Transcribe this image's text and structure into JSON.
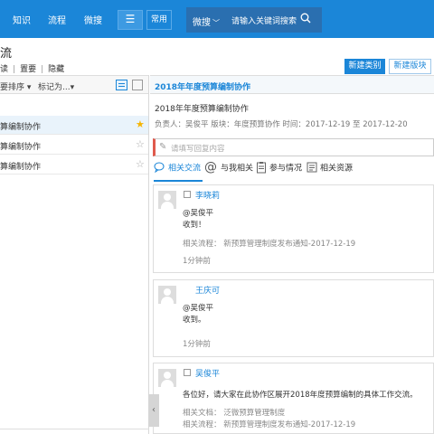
{
  "topnav": {
    "items": [
      "知识",
      "流程",
      "微搜"
    ],
    "menu_icon": "hamburger-icon",
    "favorites": "常用",
    "search_scope": "微搜",
    "search_placeholder": "请输入关键词搜索",
    "search_icon": "search-icon",
    "bg_color": "#1b86d8"
  },
  "page": {
    "title": "流",
    "filters": [
      "读",
      "置要",
      "隐藏"
    ],
    "buttons": {
      "new_category": "新建类别",
      "new_block": "新建版块"
    }
  },
  "left": {
    "sort_primary": "要排序",
    "sort_secondary": "标记为...",
    "items": [
      {
        "label": "算编制协作",
        "starred": true
      },
      {
        "label": "算编制协作",
        "starred": false
      },
      {
        "label": "算编制协作",
        "starred": false
      }
    ]
  },
  "right": {
    "header": "2018年年度预算编制协作",
    "topic_title": "2018年年度预算编制协作",
    "topic_meta": "负责人：吴俊平  版块：年度预算协作  时间：2017-12-19 至 2017-12-20",
    "reply_placeholder": "请填写回复内容",
    "tabs": [
      "相关交流",
      "与我相关",
      "参与情况",
      "相关资源"
    ],
    "posts": [
      {
        "author": "李晓莉",
        "mention": "@吴俊平",
        "body": "收到！",
        "related_label": "相关流程：",
        "related_value": "新预算管理制度发布通知-2017-12-19",
        "time": "1分钟前"
      },
      {
        "author": "王庆可",
        "mention": "@吴俊平",
        "body": "收到。",
        "time": "1分钟前"
      },
      {
        "author": "吴俊平",
        "body": "各位好，请大家在此协作区展开2018年度预算编制的具体工作交流。",
        "doc_label": "相关文档：",
        "doc_value": "泛微预算管理制度",
        "related_label": "相关流程：",
        "related_value": "新预算管理制度发布通知-2017-12-19"
      }
    ]
  },
  "colors": {
    "accent": "#1b86d8",
    "star": "#f5b400",
    "reply_accent": "#e05a4d"
  }
}
